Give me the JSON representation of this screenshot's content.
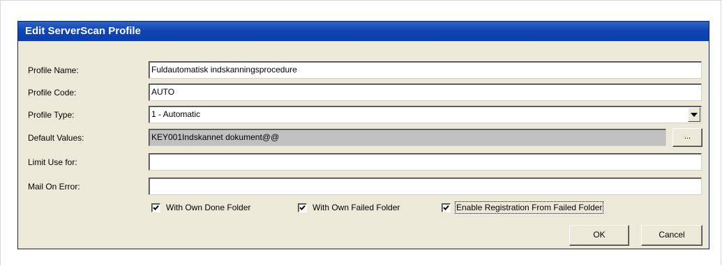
{
  "dialog": {
    "title": "Edit ServerScan Profile"
  },
  "form": {
    "profile_name_label": "Profile Name:",
    "profile_name_value": "Fuldautomatisk indskanningsprocedure",
    "profile_code_label": "Profile Code:",
    "profile_code_value": "AUTO",
    "profile_type_label": "Profile Type:",
    "profile_type_value": "1 - Automatic",
    "default_values_label": "Default Values:",
    "default_values_value": "KEY001Indskannet dokument@@",
    "browse_label": "...",
    "limit_use_label": "Limit Use for:",
    "limit_use_value": "",
    "mail_on_error_label": "Mail On Error:",
    "mail_on_error_value": ""
  },
  "checkboxes": [
    {
      "label": "With Own Done Folder",
      "checked": true
    },
    {
      "label": "With Own Failed Folder",
      "checked": true
    },
    {
      "label": "Enable Registration From Failed Folder",
      "checked": true
    }
  ],
  "buttons": {
    "ok": "OK",
    "cancel": "Cancel"
  },
  "icons": {
    "dropdown": "chevron-down-icon",
    "check": "checkmark-icon"
  },
  "colors": {
    "titlebar": "#0a3ea8",
    "dialog_bg": "#ece9d8",
    "readonly_field": "#c0c0c0"
  }
}
